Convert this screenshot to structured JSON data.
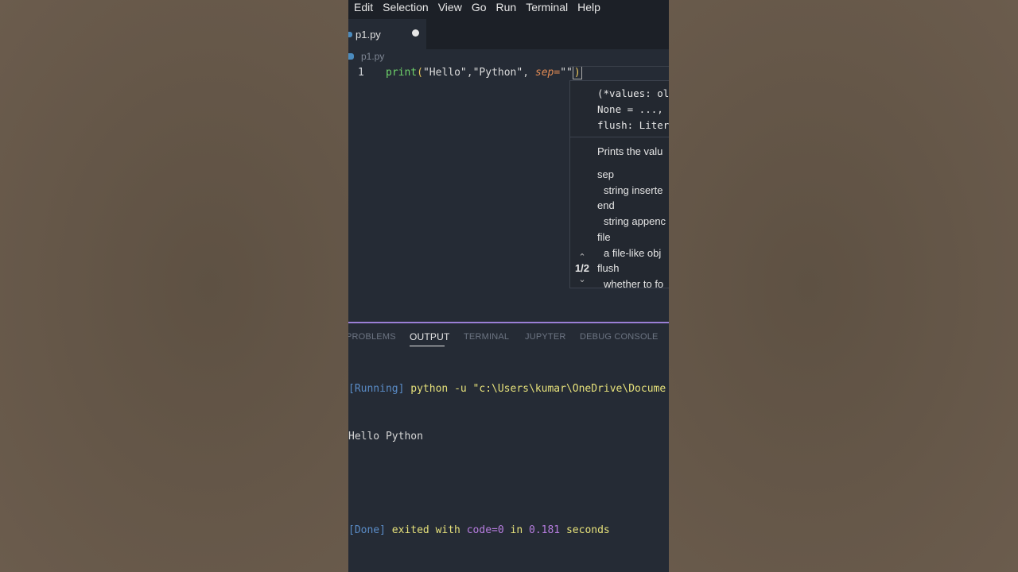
{
  "menu": {
    "items": [
      "Edit",
      "Selection",
      "View",
      "Go",
      "Run",
      "Terminal",
      "Help"
    ]
  },
  "editor": {
    "tab": {
      "label": "p1.py"
    },
    "breadcrumb": "p1.py",
    "line_number": "1",
    "code": {
      "fn": "print",
      "open": "(",
      "arg1": "\"Hello\"",
      "comma1": ",",
      "arg2": "\"Python\"",
      "comma2": ", ",
      "param": "sep=",
      "quotes": "\"\"",
      "close": ")"
    }
  },
  "hover": {
    "signature": [
      "(*values: ol",
      "None = ...,",
      "flush: Liter"
    ],
    "description": "Prints the valu",
    "params": [
      {
        "name": "sep",
        "desc": "string inserte"
      },
      {
        "name": "end",
        "desc": "string appenc"
      },
      {
        "name": "file",
        "desc": "a file-like obj"
      },
      {
        "name": "flush",
        "desc": "whether to fo"
      }
    ],
    "pager": "1/2"
  },
  "panel": {
    "tabs": {
      "problems": "PROBLEMS",
      "output": "OUTPUT",
      "terminal": "TERMINAL",
      "jupyter": "JUPYTER",
      "debug": "DEBUG CONSOLE"
    },
    "output": {
      "running_tag": "[Running]",
      "running_cmd": " python -u \"c:\\Users\\kumar\\OneDrive\\Docume",
      "result": "Hello Python",
      "done_tag": "[Done]",
      "done_text1": " exited with ",
      "done_code": "code=0",
      "done_text2": " in ",
      "done_time": "0.181",
      "done_text3": " seconds"
    }
  },
  "colors": {
    "editor_bg": "#252b35",
    "accent_border": "#9b7fd6",
    "function": "#6fd36b",
    "parameter": "#e08a54"
  }
}
